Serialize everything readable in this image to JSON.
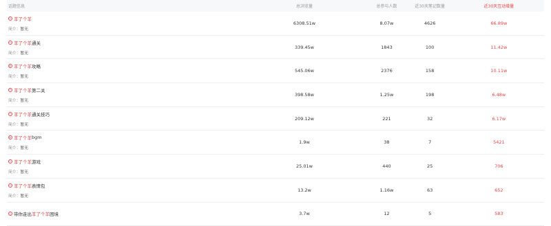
{
  "header": {
    "topic": "话题信息",
    "play": "总浏览量",
    "participants": "总参与人数",
    "duration": "近30天笔记数量",
    "increase": "近30天互动增量"
  },
  "intro_label": "简介：",
  "rows": [
    {
      "prefix": "",
      "kw": "羊了个羊",
      "suffix": "",
      "intro": "暂无",
      "play": "6308.51w",
      "participants": "8.07w",
      "duration": "4626",
      "increase": "66.89w"
    },
    {
      "prefix": "",
      "kw": "羊了个羊",
      "suffix": "通关",
      "intro": "暂无",
      "play": "339.45w",
      "participants": "1843",
      "duration": "100",
      "increase": "11.42w"
    },
    {
      "prefix": "",
      "kw": "羊了个羊",
      "suffix": "攻略",
      "intro": "暂无",
      "play": "545.06w",
      "participants": "2376",
      "duration": "158",
      "increase": "10.11w"
    },
    {
      "prefix": "",
      "kw": "羊了个羊",
      "suffix": "第二关",
      "intro": "暂无",
      "play": "398.58w",
      "participants": "1.25w",
      "duration": "198",
      "increase": "6.48w"
    },
    {
      "prefix": "",
      "kw": "羊了个羊",
      "suffix": "通关技巧",
      "intro": "暂无",
      "play": "209.12w",
      "participants": "221",
      "duration": "32",
      "increase": "6.17w"
    },
    {
      "prefix": "",
      "kw": "羊了个羊",
      "suffix": "bgm",
      "intro": "暂无",
      "play": "1.9w",
      "participants": "38",
      "duration": "7",
      "increase": "5421"
    },
    {
      "prefix": "",
      "kw": "羊了个羊",
      "suffix": "游戏",
      "intro": "暂无",
      "play": "25.01w",
      "participants": "440",
      "duration": "25",
      "increase": "706"
    },
    {
      "prefix": "",
      "kw": "羊了个羊",
      "suffix": "表情包",
      "intro": "暂无",
      "play": "13.2w",
      "participants": "1.16w",
      "duration": "63",
      "increase": "652"
    },
    {
      "prefix": "带你走出",
      "kw": "羊了个羊",
      "suffix": "困境",
      "intro": "",
      "play": "3.7w",
      "participants": "12",
      "duration": "5",
      "increase": "583"
    }
  ],
  "colors": {
    "accent": "#ee4444",
    "header_bg": "#f7f8fa",
    "muted": "#999999",
    "text": "#333333"
  },
  "icons": {
    "topic": "hot-circle-icon"
  }
}
